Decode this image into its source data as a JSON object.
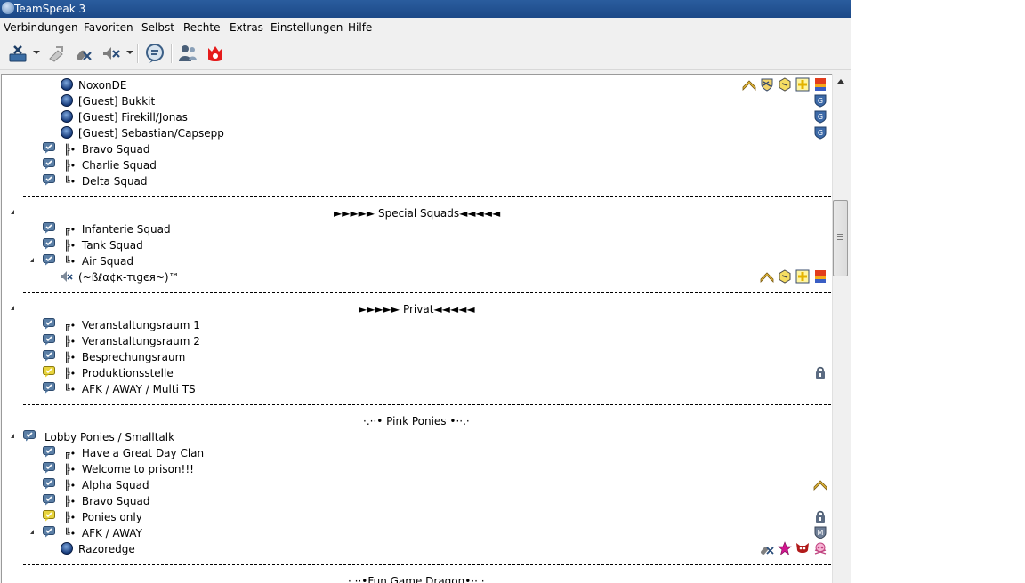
{
  "window": {
    "title": "TeamSpeak 3"
  },
  "menu": [
    "Verbindungen",
    "Favoriten",
    "Selbst",
    "Rechte",
    "Extras",
    "Einstellungen",
    "Hilfe"
  ],
  "toolbar": {
    "icons": [
      "disconnect-icon",
      "dropdown-arrow-icon",
      "away-status-icon",
      "mute-microphone-icon",
      "mute-speakers-icon",
      "dropdown-arrow-icon",
      "chat-icon",
      "contacts-icon",
      "channel-gift-icon"
    ]
  },
  "tree": [
    {
      "type": "client",
      "name": "NoxonDE",
      "badges": [
        "rank-chevron-icon",
        "shield-badge-icon",
        "hexagon-badge-icon",
        "plus-badge-icon",
        "flag-badge-icon"
      ]
    },
    {
      "type": "client",
      "name": "[Guest] Bukkit",
      "badges": [
        "guest-badge-icon"
      ]
    },
    {
      "type": "client",
      "name": "[Guest] Firekill/Jonas",
      "badges": [
        "guest-badge-icon"
      ]
    },
    {
      "type": "client",
      "name": "[Guest] Sebastian/Capsepp",
      "badges": [
        "guest-badge-icon"
      ]
    },
    {
      "type": "channel",
      "prefix": "╠•",
      "name": "Bravo Squad"
    },
    {
      "type": "channel",
      "prefix": "╠•",
      "name": "Charlie Squad"
    },
    {
      "type": "channel",
      "prefix": "╚•",
      "name": "Delta Squad"
    },
    {
      "type": "separator"
    },
    {
      "type": "spacer",
      "name": "►►►►► Special Squads◄◄◄◄◄"
    },
    {
      "type": "channel",
      "prefix": "╔•",
      "name": "Infanterie Squad"
    },
    {
      "type": "channel",
      "prefix": "╠•",
      "name": "Tank Squad"
    },
    {
      "type": "channel",
      "prefix": "╚•",
      "name": "Air Squad",
      "expanded": true
    },
    {
      "type": "client",
      "name": "(~ßℓα¢к-тιgєя~)™",
      "muted": true,
      "badges": [
        "rank-chevron-icon",
        "hexagon-badge-icon",
        "plus-badge-icon",
        "flag-badge-icon"
      ]
    },
    {
      "type": "separator"
    },
    {
      "type": "spacer",
      "name": "►►►►► Privat◄◄◄◄◄"
    },
    {
      "type": "channel",
      "prefix": "╔•",
      "name": "Veranstaltungsraum 1"
    },
    {
      "type": "channel",
      "prefix": "╠•",
      "name": "Veranstaltungsraum 2"
    },
    {
      "type": "channel",
      "prefix": "╠•",
      "name": "Besprechungsraum"
    },
    {
      "type": "channel",
      "prefix": "╠•",
      "name": "Produktionsstelle",
      "locked": true,
      "badges": [
        "lock-icon"
      ]
    },
    {
      "type": "channel",
      "prefix": "╚•",
      "name": "AFK / AWAY / Multi TS"
    },
    {
      "type": "separator"
    },
    {
      "type": "spacer",
      "name": "·.··• Pink Ponies •··.·"
    },
    {
      "type": "channel",
      "name": "Lobby Ponies  / Smalltalk",
      "level": 0,
      "expanded": true
    },
    {
      "type": "channel",
      "prefix": "╔•",
      "name": "Have a Great Day Clan"
    },
    {
      "type": "channel",
      "prefix": "╠•",
      "name": "Welcome to prison!!!"
    },
    {
      "type": "channel",
      "prefix": "╠•",
      "name": "Alpha Squad",
      "badges": [
        "rank-chevron-icon"
      ]
    },
    {
      "type": "channel",
      "prefix": "╠•",
      "name": "Bravo Squad"
    },
    {
      "type": "channel",
      "prefix": "╠•",
      "name": "Ponies only",
      "locked": true,
      "badges": [
        "lock-icon"
      ]
    },
    {
      "type": "channel",
      "prefix": "╚•",
      "name": "AFK / AWAY",
      "expanded": true,
      "badges": [
        "moderated-badge-icon"
      ]
    },
    {
      "type": "client",
      "name": "Razoredge",
      "badges": [
        "mic-muted-icon",
        "star-badge-icon",
        "demon-badge-icon",
        "skull-badge-icon"
      ]
    },
    {
      "type": "separator"
    },
    {
      "type": "spacer",
      "name": "·.··•Fun Game Dragon•··.·"
    }
  ]
}
